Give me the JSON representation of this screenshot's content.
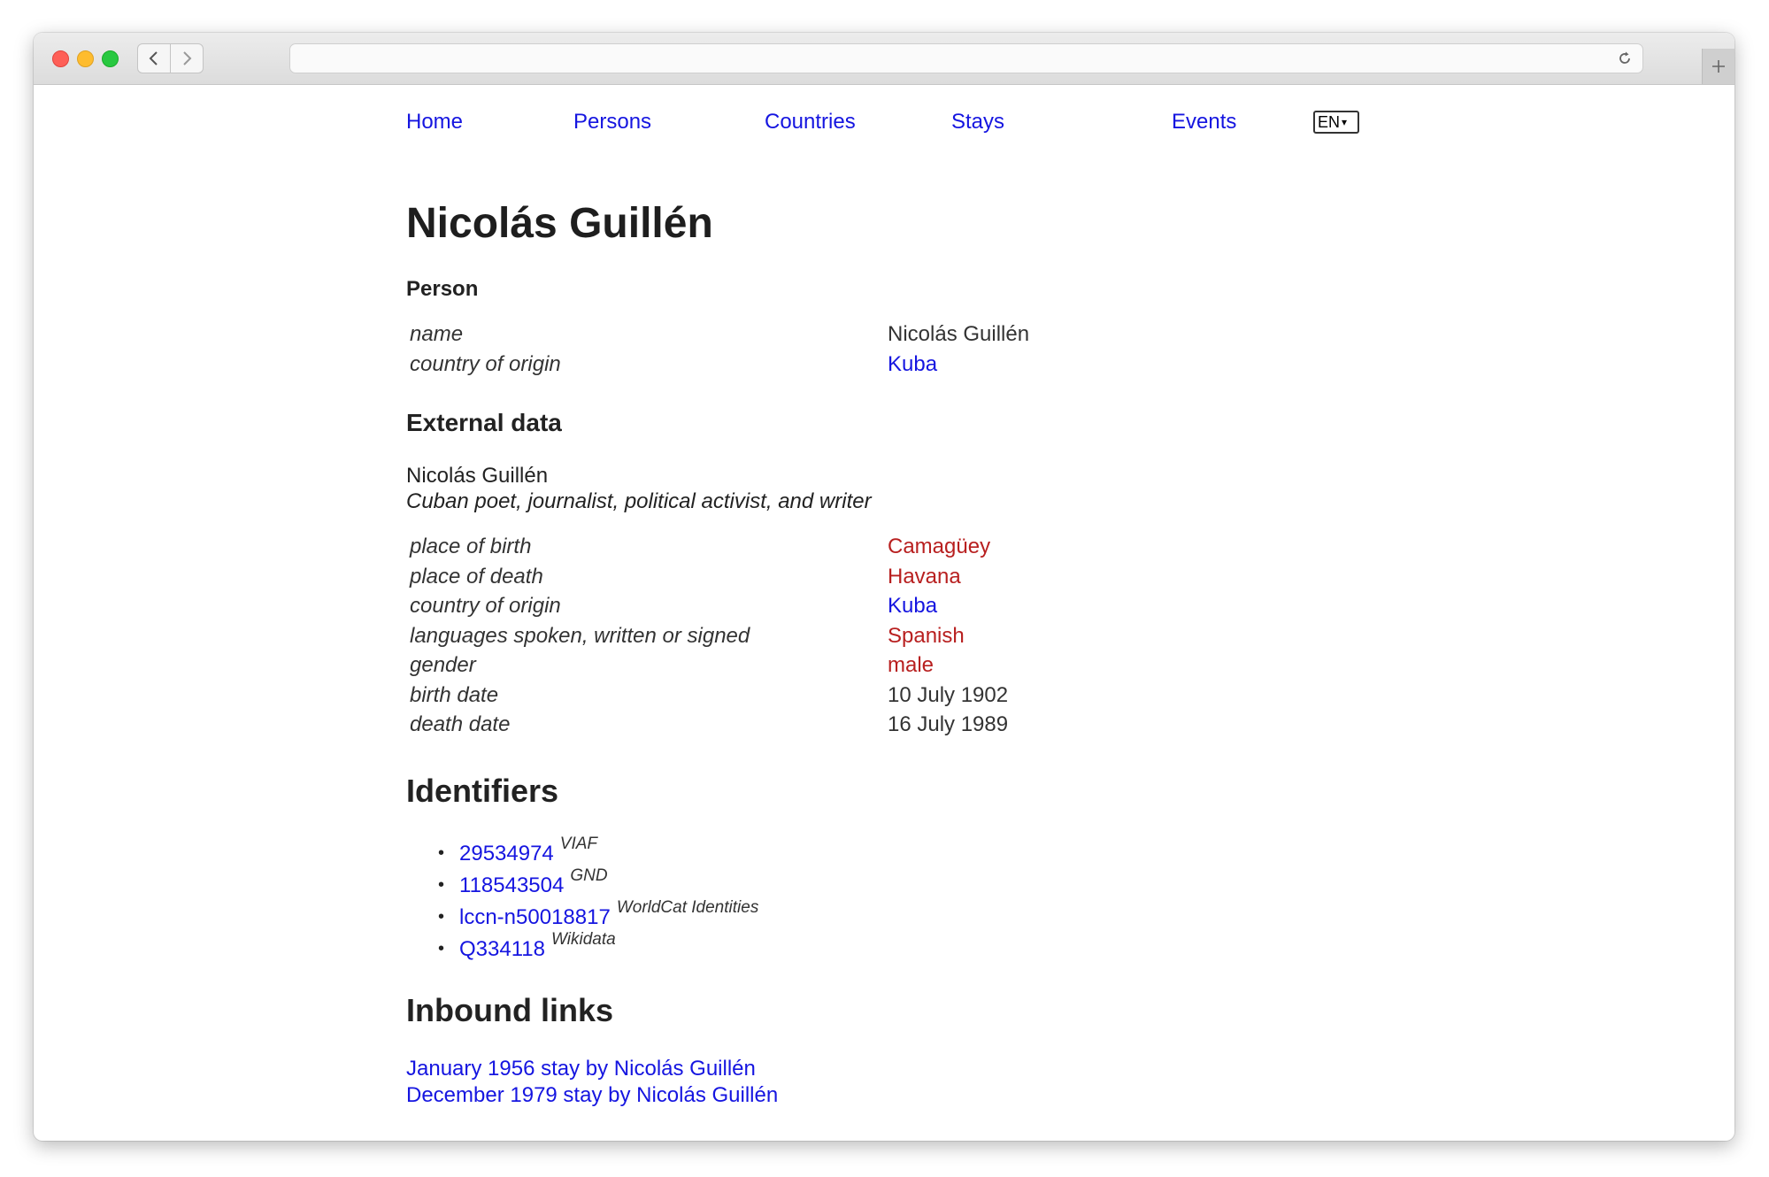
{
  "nav": {
    "items": [
      "Home",
      "Persons",
      "Countries",
      "Stays",
      "Events"
    ],
    "language": "EN"
  },
  "page": {
    "title": "Nicolás Guillén"
  },
  "person": {
    "heading": "Person",
    "rows": [
      {
        "key": "name",
        "value": "Nicolás Guillén",
        "type": "plain"
      },
      {
        "key": "country of origin",
        "value": "Kuba",
        "type": "link"
      }
    ]
  },
  "external": {
    "heading": "External data",
    "name": "Nicolás Guillén",
    "description": "Cuban poet, journalist, political activist, and writer",
    "rows": [
      {
        "key": "place of birth",
        "value": "Camagüey",
        "type": "ext"
      },
      {
        "key": "place of death",
        "value": "Havana",
        "type": "ext"
      },
      {
        "key": "country of origin",
        "value": "Kuba",
        "type": "link"
      },
      {
        "key": "languages spoken, written or signed",
        "value": "Spanish",
        "type": "ext"
      },
      {
        "key": "gender",
        "value": "male",
        "type": "ext"
      },
      {
        "key": "birth date",
        "value": "10 July 1902",
        "type": "plain"
      },
      {
        "key": "death date",
        "value": "16 July 1989",
        "type": "plain"
      }
    ]
  },
  "identifiers": {
    "heading": "Identifiers",
    "items": [
      {
        "id": "29534974",
        "source": "VIAF"
      },
      {
        "id": "118543504",
        "source": "GND"
      },
      {
        "id": "lccn-n50018817",
        "source": "WorldCat Identities"
      },
      {
        "id": "Q334118",
        "source": "Wikidata"
      }
    ]
  },
  "inbound": {
    "heading": "Inbound links",
    "links": [
      "January 1956 stay by Nicolás Guillén",
      "December 1979 stay by Nicolás Guillén"
    ]
  },
  "colors": {
    "link": "#1515e0",
    "external_link": "#b81f1f",
    "text": "#222222"
  }
}
